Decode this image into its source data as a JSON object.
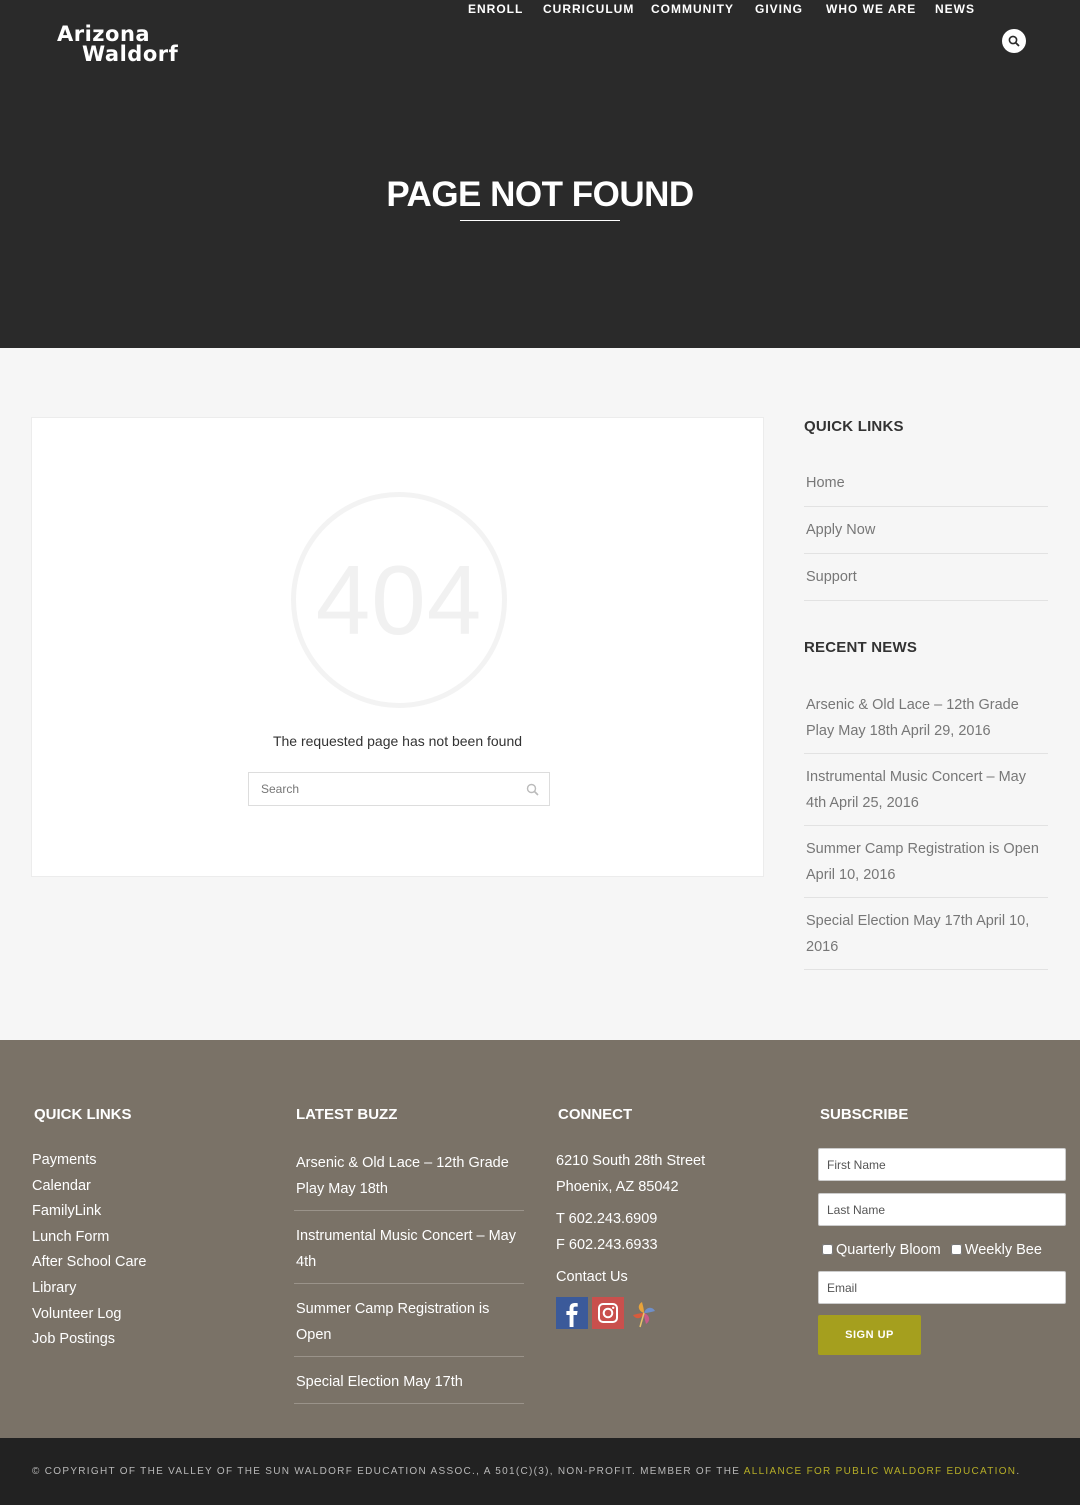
{
  "header": {
    "logo_line1": "Arizona",
    "logo_line2": "Waldorf",
    "nav": [
      "ENROLL",
      "CURRICULUM",
      "COMMUNITY",
      "GIVING",
      "WHO WE ARE",
      "NEWS"
    ],
    "search_icon": "search-icon"
  },
  "page": {
    "title": "PAGE NOT FOUND",
    "error_code": "404",
    "message": "The requested page has not been found",
    "search_placeholder": "Search"
  },
  "sidebar": {
    "quick_links_heading": "QUICK LINKS",
    "quick_links": [
      "Home",
      "Apply Now",
      "Support"
    ],
    "recent_news_heading": "RECENT NEWS",
    "recent_news": [
      "Arsenic & Old Lace – 12th Grade Play May 18th April 29, 2016",
      "Instrumental Music Concert – May 4th April 25, 2016",
      "Summer Camp Registration is Open April 10, 2016",
      "Special Election May 17th April 10, 2016"
    ]
  },
  "footer": {
    "quick_links_heading": "QUICK LINKS",
    "quick_links": [
      "Payments",
      "Calendar",
      "FamilyLink",
      "Lunch Form",
      "After School Care",
      "Library",
      "Volunteer Log",
      "Job Postings"
    ],
    "latest_buzz_heading": "LATEST BUZZ",
    "latest_buzz": [
      "Arsenic & Old Lace – 12th Grade Play May 18th",
      "Instrumental Music Concert – May 4th",
      "Summer Camp Registration is Open",
      "Special Election May 17th"
    ],
    "connect_heading": "CONNECT",
    "address_line1": "6210 South 28th Street",
    "address_line2": "Phoenix, AZ 85042",
    "phone": "T 602.243.6909",
    "fax": "F 602.243.6933",
    "contact": "Contact Us",
    "social": [
      "facebook-icon",
      "instagram-icon",
      "pinwheel-icon"
    ],
    "subscribe_heading": "SUBSCRIBE",
    "first_name_placeholder": "First Name",
    "last_name_placeholder": "Last Name",
    "checkbox_quarterly": "Quarterly Bloom",
    "checkbox_weekly": "Weekly Bee",
    "email_placeholder": "Email",
    "signup_label": "SIGN UP"
  },
  "copyright": {
    "text": "© COPYRIGHT OF THE VALLEY OF THE SUN WALDORF EDUCATION ASSOC., A 501(C)(3), NON-PROFIT. MEMBER OF THE ",
    "link": "ALLIANCE FOR PUBLIC WALDORF EDUCATION",
    "end": "."
  },
  "colors": {
    "header_bg": "#2a2a2a",
    "footer_bg": "#7a7267",
    "accent": "#a59f1e",
    "bottom_bg": "#222222"
  }
}
